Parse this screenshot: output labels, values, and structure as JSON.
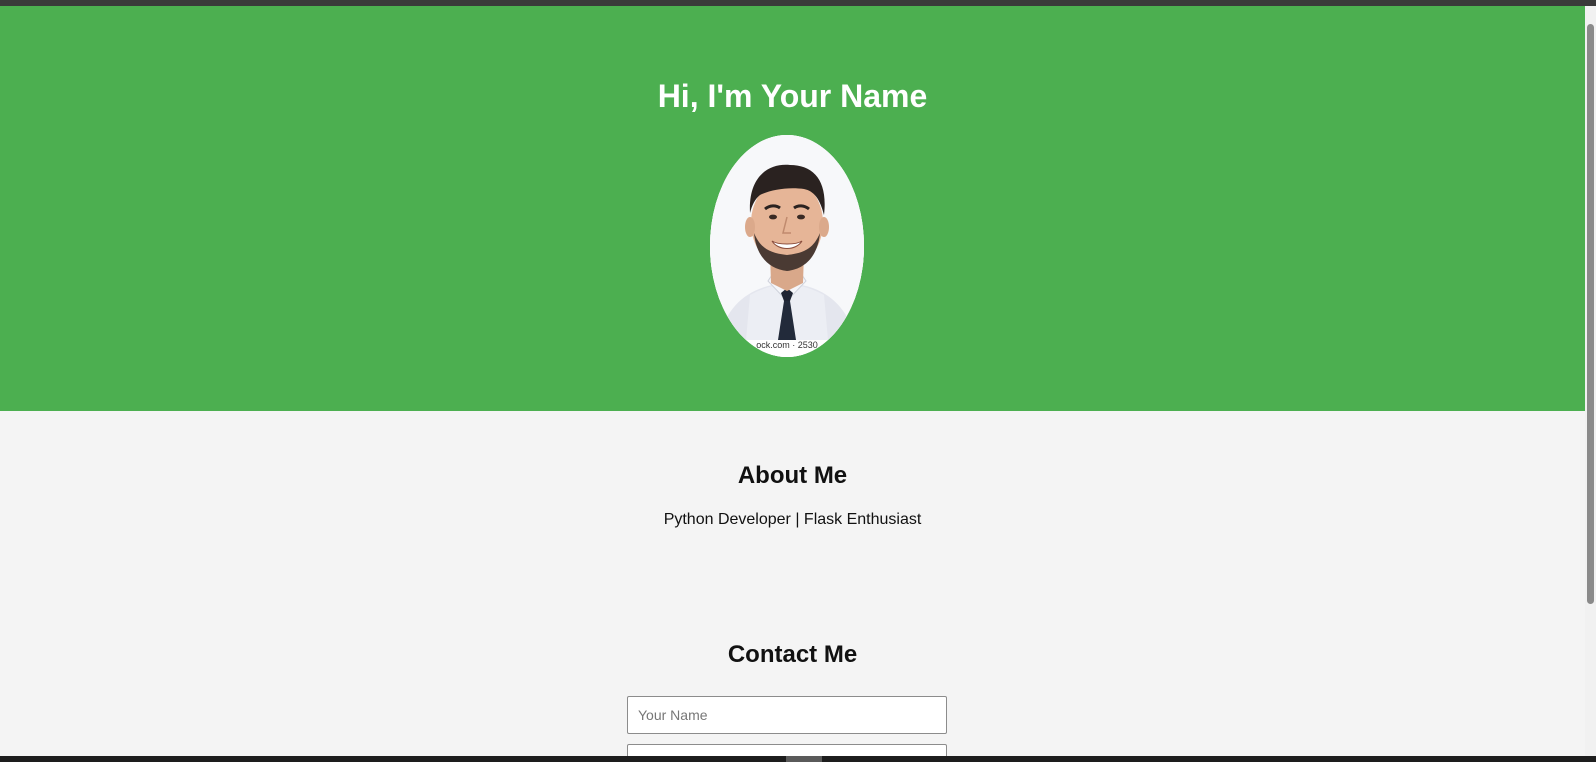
{
  "hero": {
    "title": "Hi, I'm Your Name",
    "photo_watermark": "ock.com · 2530",
    "background_color": "#4caf50"
  },
  "about": {
    "title": "About Me",
    "text": "Python Developer | Flask Enthusiast"
  },
  "contact": {
    "title": "Contact Me",
    "name_placeholder": "Your Name",
    "email_placeholder": ""
  }
}
